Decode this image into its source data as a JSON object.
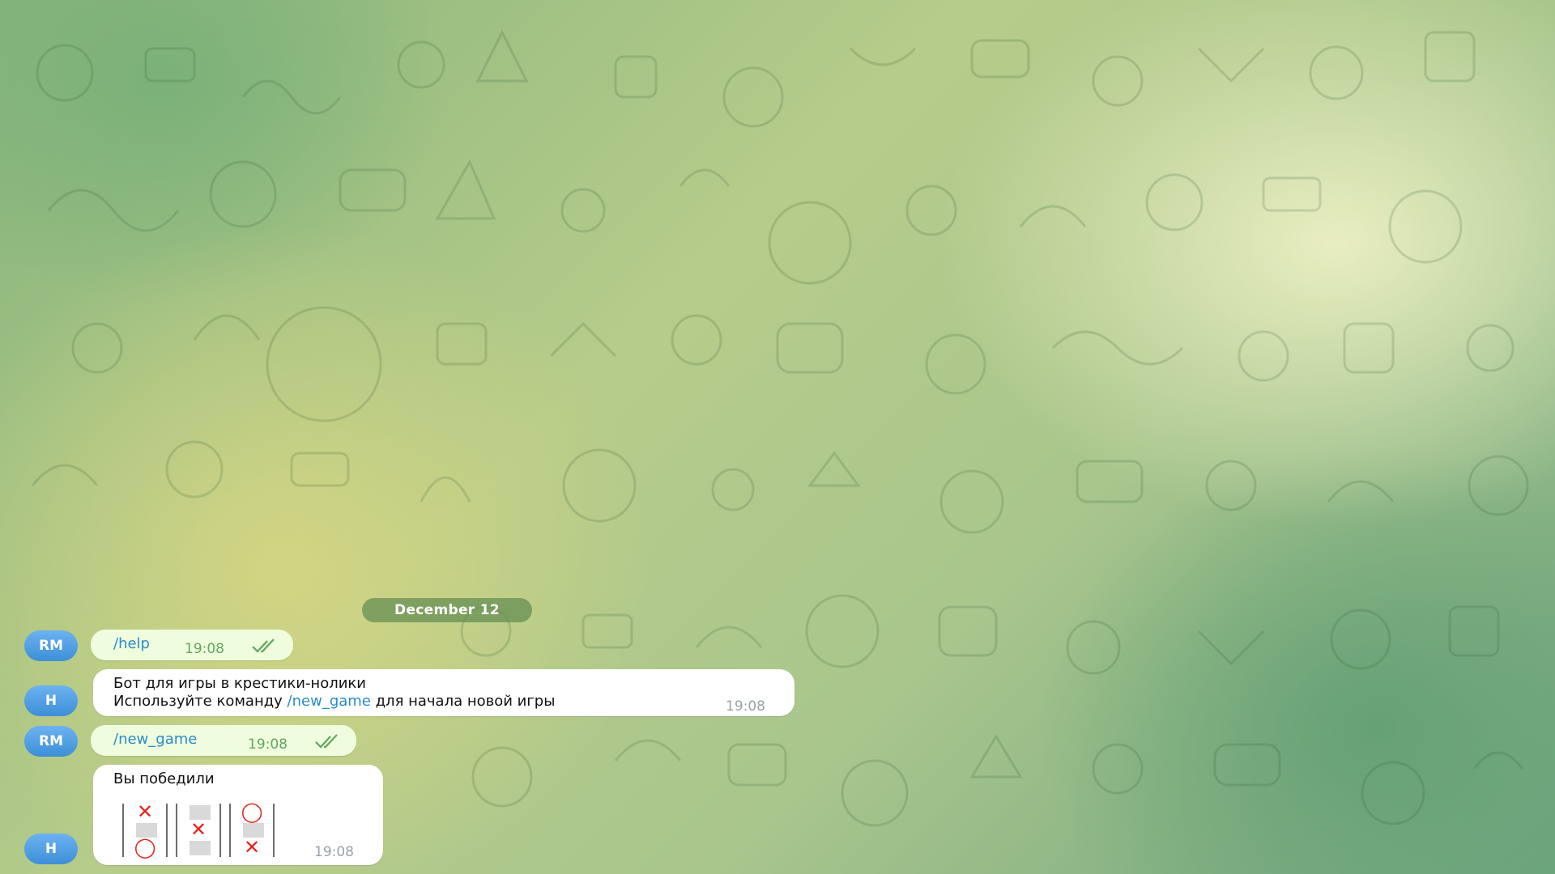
{
  "chat": {
    "date_label": "December 12",
    "messages": [
      {
        "sender_initials": "RM",
        "direction": "outgoing",
        "command": "/help",
        "time": "19:08",
        "status": "read"
      },
      {
        "sender_initials": "H",
        "direction": "incoming",
        "line1": "Бот для игры в крестики-нолики",
        "line2_prefix": "Используйте команду ",
        "line2_command": "/new_game",
        "line2_suffix": " для начала новой игры",
        "time": "19:08"
      },
      {
        "sender_initials": "RM",
        "direction": "outgoing",
        "command": "/new_game",
        "time": "19:08",
        "status": "read"
      },
      {
        "sender_initials": "H",
        "direction": "incoming",
        "text": "Вы победили",
        "time": "19:08",
        "board": [
          [
            "X",
            "empty",
            "O"
          ],
          [
            "empty",
            "X",
            "empty"
          ],
          [
            "O",
            "empty",
            "X"
          ]
        ]
      }
    ]
  },
  "colors": {
    "avatar": "#4a9be0",
    "command_link": "#2a8cc8",
    "time_outgoing": "#5fa660",
    "time_incoming": "#9aa2a8",
    "board_mark": "#e5251f"
  },
  "icons": {
    "read_status": "double-check-icon"
  }
}
